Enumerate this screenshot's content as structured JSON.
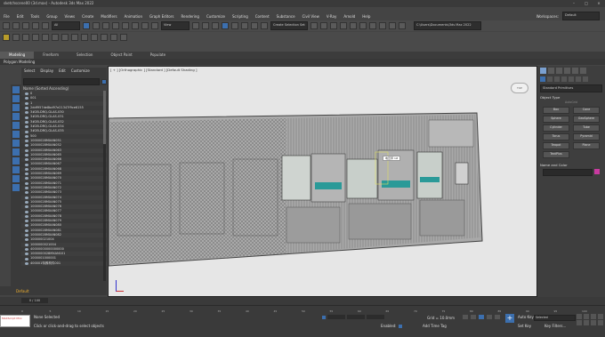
{
  "window": {
    "title": "sketchscene00 (3d.max) - Autodesk 3ds Max 2022"
  },
  "menu": {
    "items": [
      "File",
      "Edit",
      "Tools",
      "Group",
      "Views",
      "Create",
      "Modifiers",
      "Animation",
      "Graph Editors",
      "Rendering",
      "Customize",
      "Scripting",
      "Content",
      "Substance",
      "Civil View",
      "V-Ray",
      "Arnold",
      "Help"
    ],
    "workspaces_label": "Workspaces:",
    "workspace_value": "Default"
  },
  "toolbar": {
    "view_combo": "View",
    "selection_set_combo": "Create Selection Set",
    "project_path": "C:\\Users\\Documents\\3ds Max 2022"
  },
  "ribbon": {
    "tabs": [
      "Modeling",
      "Freeform",
      "Selection",
      "Object Paint",
      "Populate"
    ],
    "active_tab": "Modeling",
    "subtitle": "Polygon Modeling"
  },
  "scene_explorer": {
    "menu": [
      "Select",
      "Display",
      "Edit",
      "Customize"
    ],
    "column_header": "Name (Sorted Ascending)",
    "rows": [
      "0",
      "001",
      "1",
      "2ddf957de8bd97e21347f9ce6155",
      "3#2B-DRQ-GLAS-030",
      "3#2B-DRQ-GLAS-031",
      "3#2B-DRQ-GLAS-032",
      "3#2B-DRQ-GLAS-034",
      "3#2B-DRQ-GLAS-035",
      "500",
      "10000028MXAN051",
      "10000028MXAN052",
      "10000028MXAN063",
      "10000028MXAN065",
      "10000028MXAN066",
      "10000028MXAN067",
      "10000028MXAN068",
      "10000028MXAN069",
      "10000028MXAN070",
      "10000028MXAN071",
      "10000028MXAN072",
      "10000028MXAN073",
      "10000028MXAN074",
      "10000028MXAN075",
      "10000028MXAN076",
      "10000028MXAN077",
      "10000028MXAN078",
      "10000028MXAN079",
      "10000028MXAN080",
      "10000028MXAN081",
      "10000028MXAN082",
      "100000021004",
      "1000000021004",
      "40000000000000000",
      "1000000028MXAN101",
      "1000001000001",
      "400001特殊构件001"
    ]
  },
  "layer": {
    "name": "Default"
  },
  "viewport": {
    "label": "[ + ] [Orthographic ] [Standard ] [Default Shading ]",
    "navcube_label": "TOP",
    "tooltip": "电压师 1#"
  },
  "command_panel": {
    "category_dropdown": "Standard Primitives",
    "object_type_title": "Object Type",
    "autogrid_label": "AutoGrid",
    "buttons": [
      "Box",
      "Cone",
      "Sphere",
      "GeoSphere",
      "Cylinder",
      "Tube",
      "Torus",
      "Pyramid",
      "Teapot",
      "Plane",
      "TextPlus"
    ],
    "name_color_title": "Name and Color"
  },
  "timeline": {
    "frame": "0 / 100",
    "ticks": [
      "0",
      "5",
      "10",
      "15",
      "20",
      "25",
      "30",
      "35",
      "40",
      "45",
      "50",
      "55",
      "60",
      "65",
      "70",
      "75",
      "80",
      "85",
      "90",
      "95",
      "100"
    ]
  },
  "status": {
    "mini_listener": "MAXScript Mini",
    "line1": "None Selected",
    "line2": "Click or click-and-drag to select objects",
    "grid": "Grid = 10.0mm",
    "enabled_label": "Enabled:",
    "add_time_tag": "Add Time Tag",
    "auto_key": "Auto Key",
    "set_key": "Set Key",
    "selected_combo": "Selected",
    "key_filters": "Key Filters..."
  },
  "colors": {
    "accent": "#3c6fae",
    "layer": "#f0b030",
    "object_color": "#c83aa0",
    "viewport_bg": "#e6e6e6"
  }
}
